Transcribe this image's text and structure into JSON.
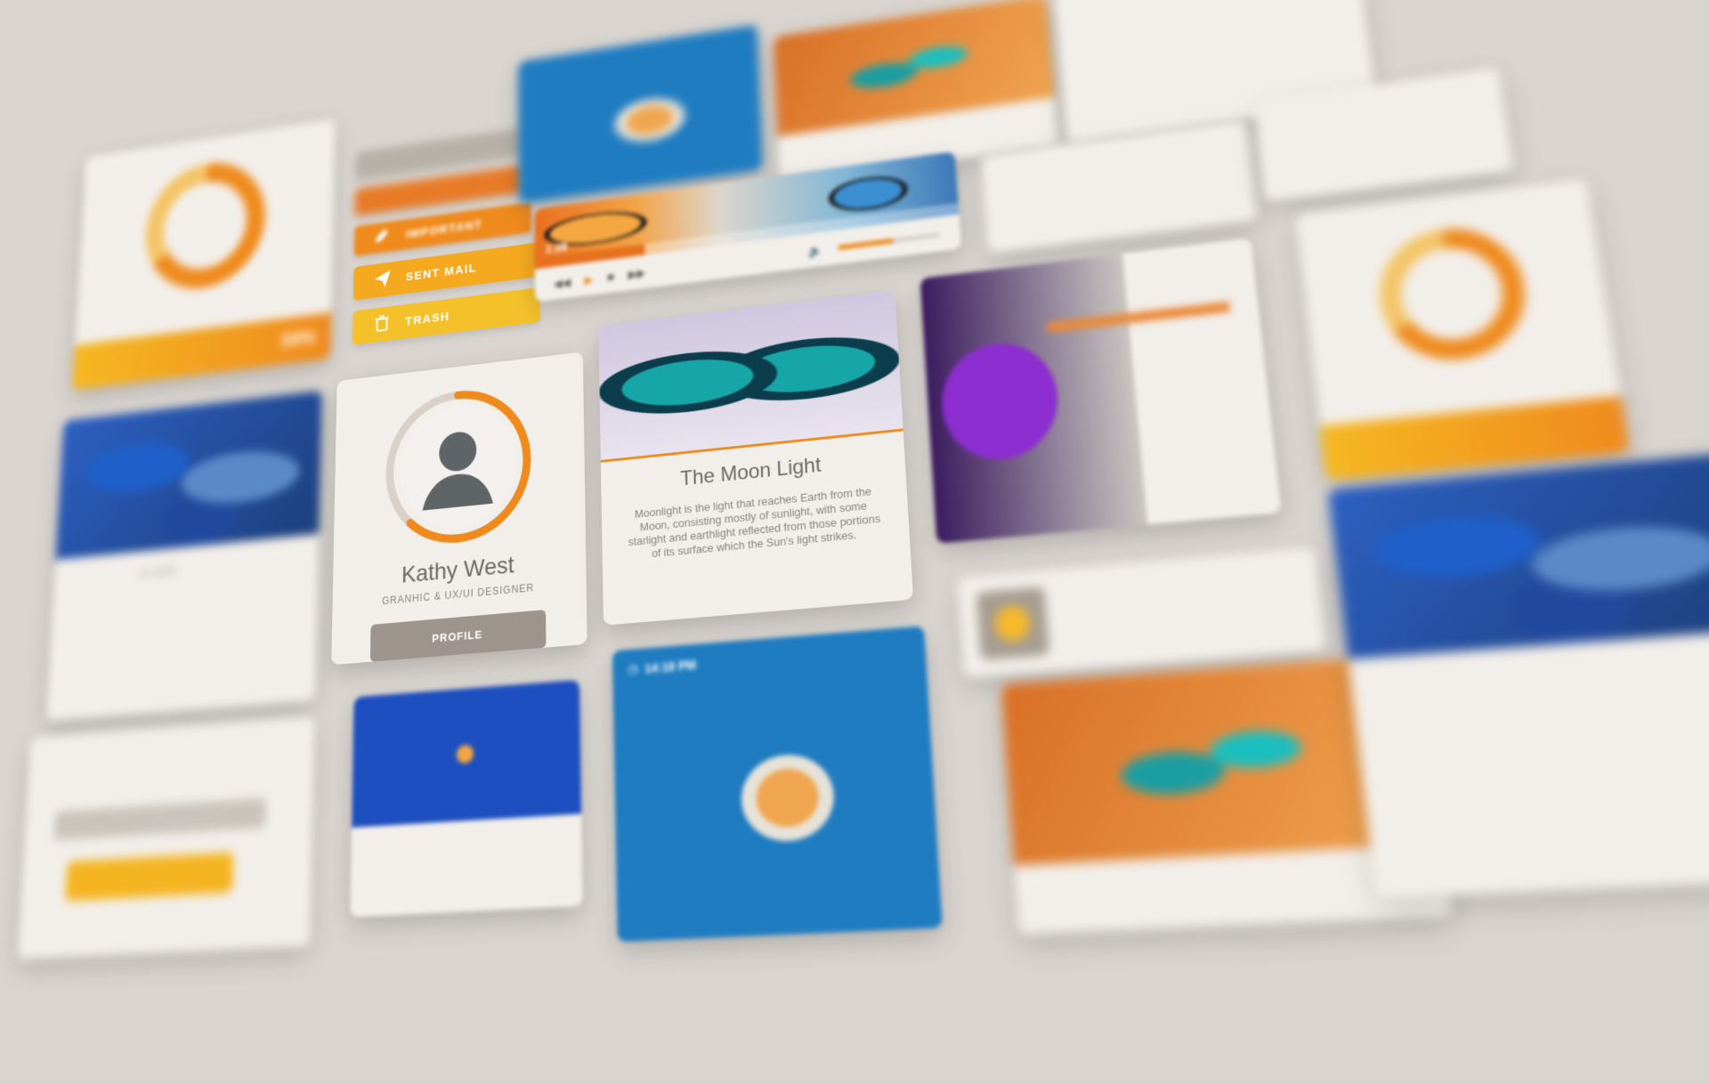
{
  "buttons": [
    {
      "label": "IMPORTANT",
      "icon": "rocket-icon"
    },
    {
      "label": "SENT MAIL",
      "icon": "paper-plane-icon"
    },
    {
      "label": "TRASH",
      "icon": "trash-icon"
    }
  ],
  "player": {
    "time": "1:28",
    "progress": 0.27,
    "volume": 0.55
  },
  "profile": {
    "name": "Kathy West",
    "role": "GRANHIC & UX/UI DESIGNER",
    "button_label": "PROFILE",
    "ring_progress": 0.62
  },
  "moon_card": {
    "title": "The Moon Light",
    "body": "Moonlight is the light that reaches Earth from the Moon, consisting mostly of sunlight, with some starlight and earthlight reflected from those portions of its surface which the Sun's light strikes."
  },
  "weather_card": {
    "caption": "in 2016"
  },
  "fish_card": {
    "time": "14:18 PM"
  },
  "stats_card": {
    "percent": "34%"
  },
  "colors": {
    "orange": "#ef8a1d",
    "yellow": "#f5b821",
    "gray_button": "#9d958d",
    "background": "#d9d4cf"
  }
}
